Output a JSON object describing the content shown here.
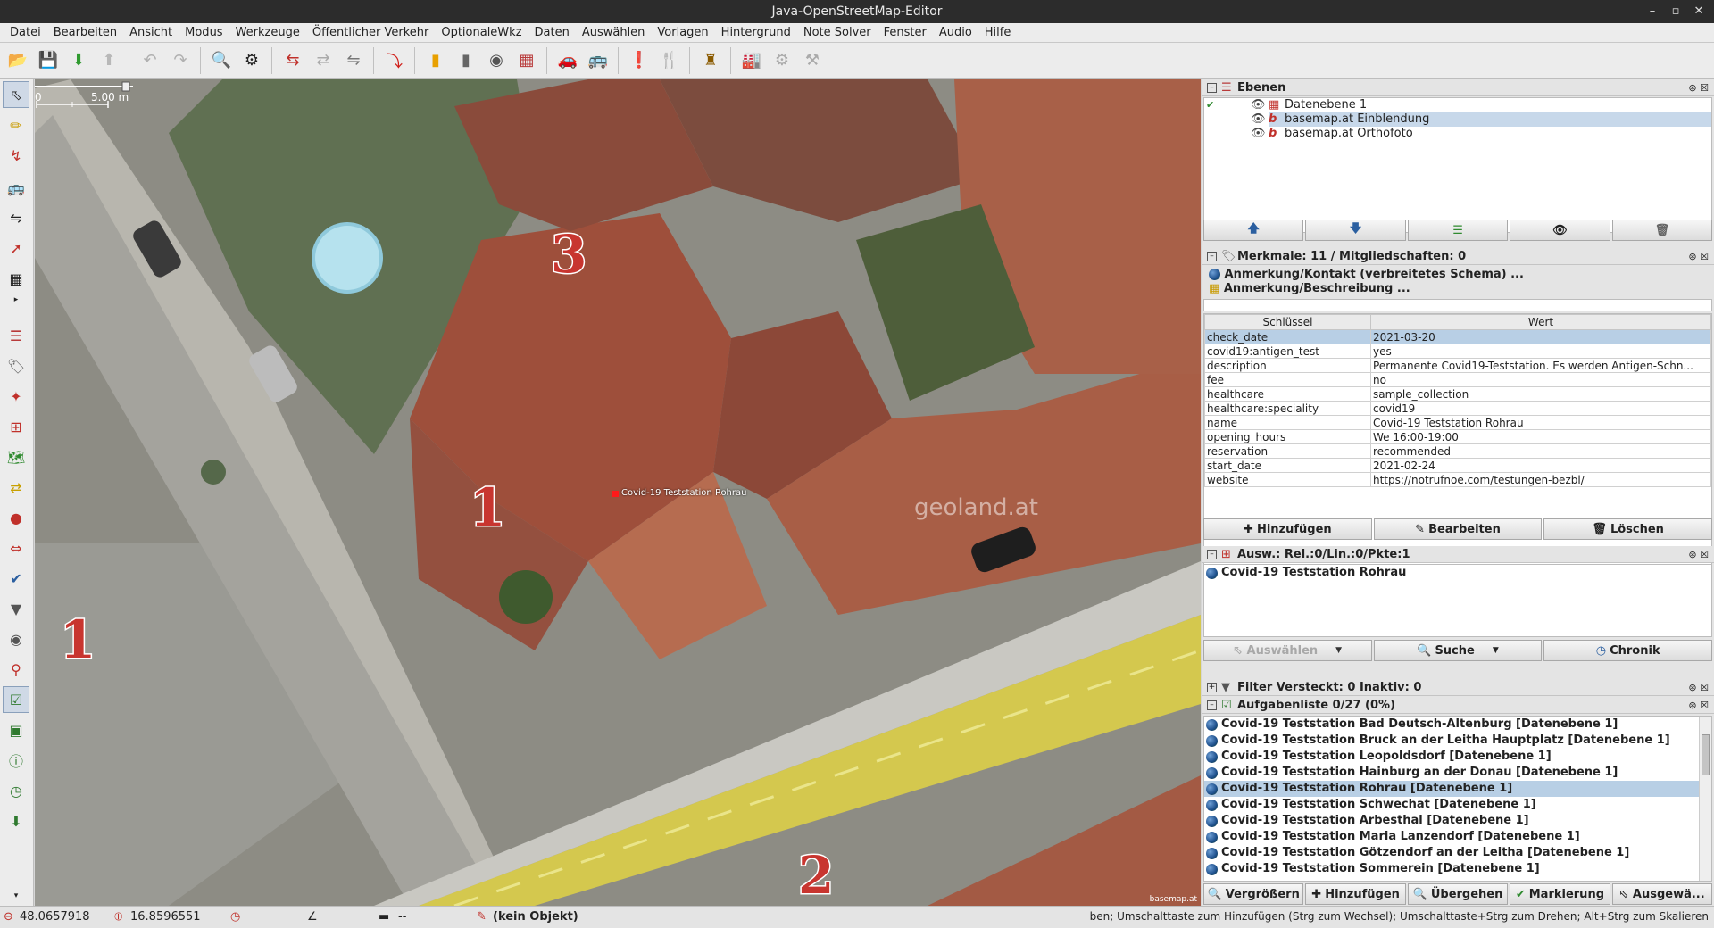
{
  "window": {
    "title": "Java-OpenStreetMap-Editor"
  },
  "menu": [
    "Datei",
    "Bearbeiten",
    "Ansicht",
    "Modus",
    "Werkzeuge",
    "Öffentlicher Verkehr",
    "OptionaleWkz",
    "Daten",
    "Auswählen",
    "Vorlagen",
    "Hintergrund",
    "Note Solver",
    "Fenster",
    "Audio",
    "Hilfe"
  ],
  "map": {
    "scale_label": "5.00 m",
    "scale_zero": "0",
    "node_label": "Covid-19 Teststation Rohrau",
    "house_numbers": [
      "3",
      "1",
      "1",
      "2"
    ],
    "watermark": "geoland.at",
    "attribution": "basemap.at"
  },
  "layers": {
    "title": "Ebenen",
    "items": [
      {
        "name": "Datenebene 1"
      },
      {
        "name": "basemap.at Einblendung"
      },
      {
        "name": "basemap.at Orthofoto"
      }
    ]
  },
  "tags": {
    "title": "Merkmale: 11 / Mitgliedschaften: 0",
    "preset1": "Anmerkung/Kontakt (verbreitetes Schema) ...",
    "preset2": "Anmerkung/Beschreibung ...",
    "col_key": "Schlüssel",
    "col_value": "Wert",
    "rows": [
      {
        "k": "check_date",
        "v": "2021-03-20"
      },
      {
        "k": "covid19:antigen_test",
        "v": "yes"
      },
      {
        "k": "description",
        "v": "Permanente Covid19-Teststation. Es werden Antigen-Schn..."
      },
      {
        "k": "fee",
        "v": "no"
      },
      {
        "k": "healthcare",
        "v": "sample_collection"
      },
      {
        "k": "healthcare:speciality",
        "v": "covid19"
      },
      {
        "k": "name",
        "v": "Covid-19 Teststation Rohrau"
      },
      {
        "k": "opening_hours",
        "v": "We 16:00-19:00"
      },
      {
        "k": "reservation",
        "v": "recommended"
      },
      {
        "k": "start_date",
        "v": "2021-02-24"
      },
      {
        "k": "website",
        "v": "https://notrufnoe.com/testungen-bezbl/"
      }
    ],
    "btn_add": "Hinzufügen",
    "btn_edit": "Bearbeiten",
    "btn_delete": "Löschen"
  },
  "selection": {
    "title": "Ausw.: Rel.:0/Lin.:0/Pkte:1",
    "item": "Covid-19 Teststation Rohrau",
    "btn_select": "Auswählen",
    "btn_search": "Suche",
    "btn_history": "Chronik"
  },
  "filter": {
    "title": "Filter Versteckt: 0 Inaktiv: 0"
  },
  "todo": {
    "title": "Aufgabenliste 0/27 (0%)",
    "items": [
      "Covid-19 Teststation Bad Deutsch-Altenburg [Datenebene 1]",
      "Covid-19 Teststation Bruck an der Leitha Hauptplatz [Datenebene 1]",
      "Covid-19 Teststation Leopoldsdorf [Datenebene 1]",
      "Covid-19 Teststation Hainburg an der Donau [Datenebene 1]",
      "Covid-19 Teststation Rohrau [Datenebene 1]",
      "Covid-19 Teststation Schwechat [Datenebene 1]",
      "Covid-19 Teststation Arbesthal [Datenebene 1]",
      "Covid-19 Teststation Maria Lanzendorf [Datenebene 1]",
      "Covid-19 Teststation Götzendorf an der Leitha [Datenebene 1]",
      "Covid-19 Teststation Sommerein [Datenebene 1]"
    ],
    "selected_index": 4,
    "btn_zoom": "Vergrößern",
    "btn_add": "Hinzufügen",
    "btn_skip": "Übergehen",
    "btn_mark": "Markierung",
    "btn_selected": "Ausgewä..."
  },
  "status": {
    "lat": "48.0657918",
    "lon": "16.8596551",
    "angle": "",
    "distance": "--",
    "object": "(kein Objekt)",
    "hint": "ben; Umschalttaste zum Hinzufügen (Strg zum Wechsel); Umschalttaste+Strg zum Drehen; Alt+Strg zum Skalieren"
  }
}
